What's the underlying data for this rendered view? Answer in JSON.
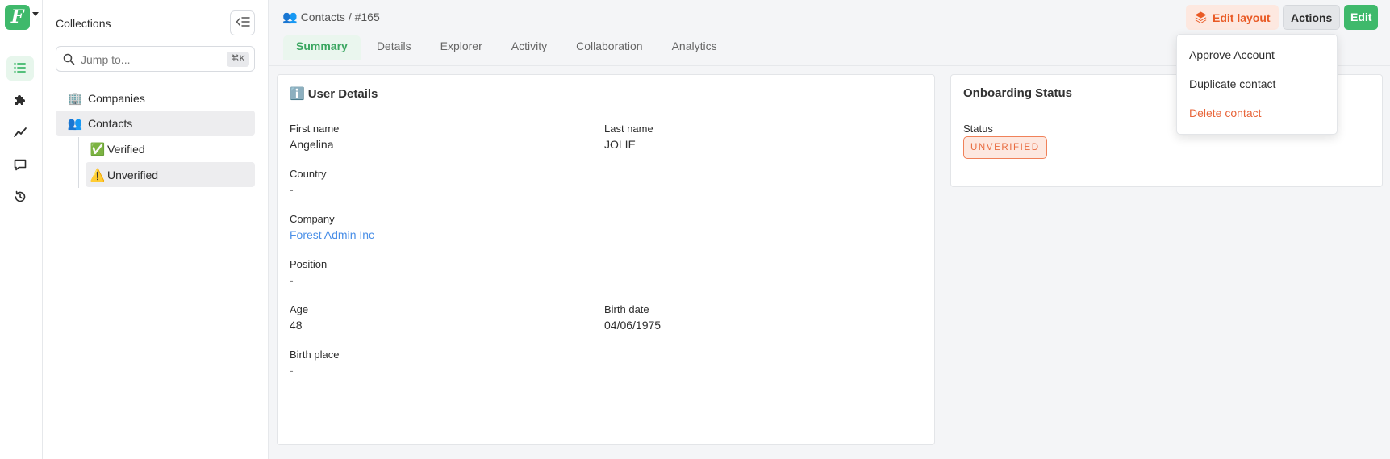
{
  "app": {
    "logo_letter": "F",
    "accent_color": "#3fb96b"
  },
  "rail": {
    "items": [
      {
        "icon": "list-icon",
        "active": true
      },
      {
        "icon": "puzzle-icon",
        "active": false
      },
      {
        "icon": "chart-line-icon",
        "active": false
      },
      {
        "icon": "chat-icon",
        "active": false
      },
      {
        "icon": "history-icon",
        "active": false
      }
    ]
  },
  "collections": {
    "title": "Collections",
    "search_placeholder": "Jump to...",
    "search_shortcut": "⌘K",
    "items": [
      {
        "emoji": "🏢",
        "label": "Companies"
      },
      {
        "emoji": "👥",
        "label": "Contacts"
      },
      {
        "emoji": "✅",
        "label": "Verified"
      },
      {
        "emoji": "⚠️",
        "label": "Unverified"
      }
    ]
  },
  "header": {
    "breadcrumb_emoji": "👥",
    "breadcrumb": "Contacts / #165",
    "tabs": [
      "Summary",
      "Details",
      "Explorer",
      "Activity",
      "Collaboration",
      "Analytics"
    ],
    "edit_layout_label": "Edit layout",
    "actions_label": "Actions",
    "edit_label": "Edit"
  },
  "user_details": {
    "title_emoji": "ℹ️",
    "title": "User Details",
    "first_name_label": "First name",
    "first_name": "Angelina",
    "last_name_label": "Last name",
    "last_name": "JOLIE",
    "country_label": "Country",
    "country": "-",
    "company_label": "Company",
    "company": "Forest Admin Inc",
    "position_label": "Position",
    "position": "-",
    "age_label": "Age",
    "age": "48",
    "birth_date_label": "Birth date",
    "birth_date": "04/06/1975",
    "birth_place_label": "Birth place",
    "birth_place": "-"
  },
  "onboarding": {
    "title": "Onboarding Status",
    "status_label": "Status",
    "status_value": "UNVERIFIED"
  },
  "actions_menu": {
    "items": [
      "Approve Account",
      "Duplicate contact",
      "Delete contact"
    ]
  }
}
